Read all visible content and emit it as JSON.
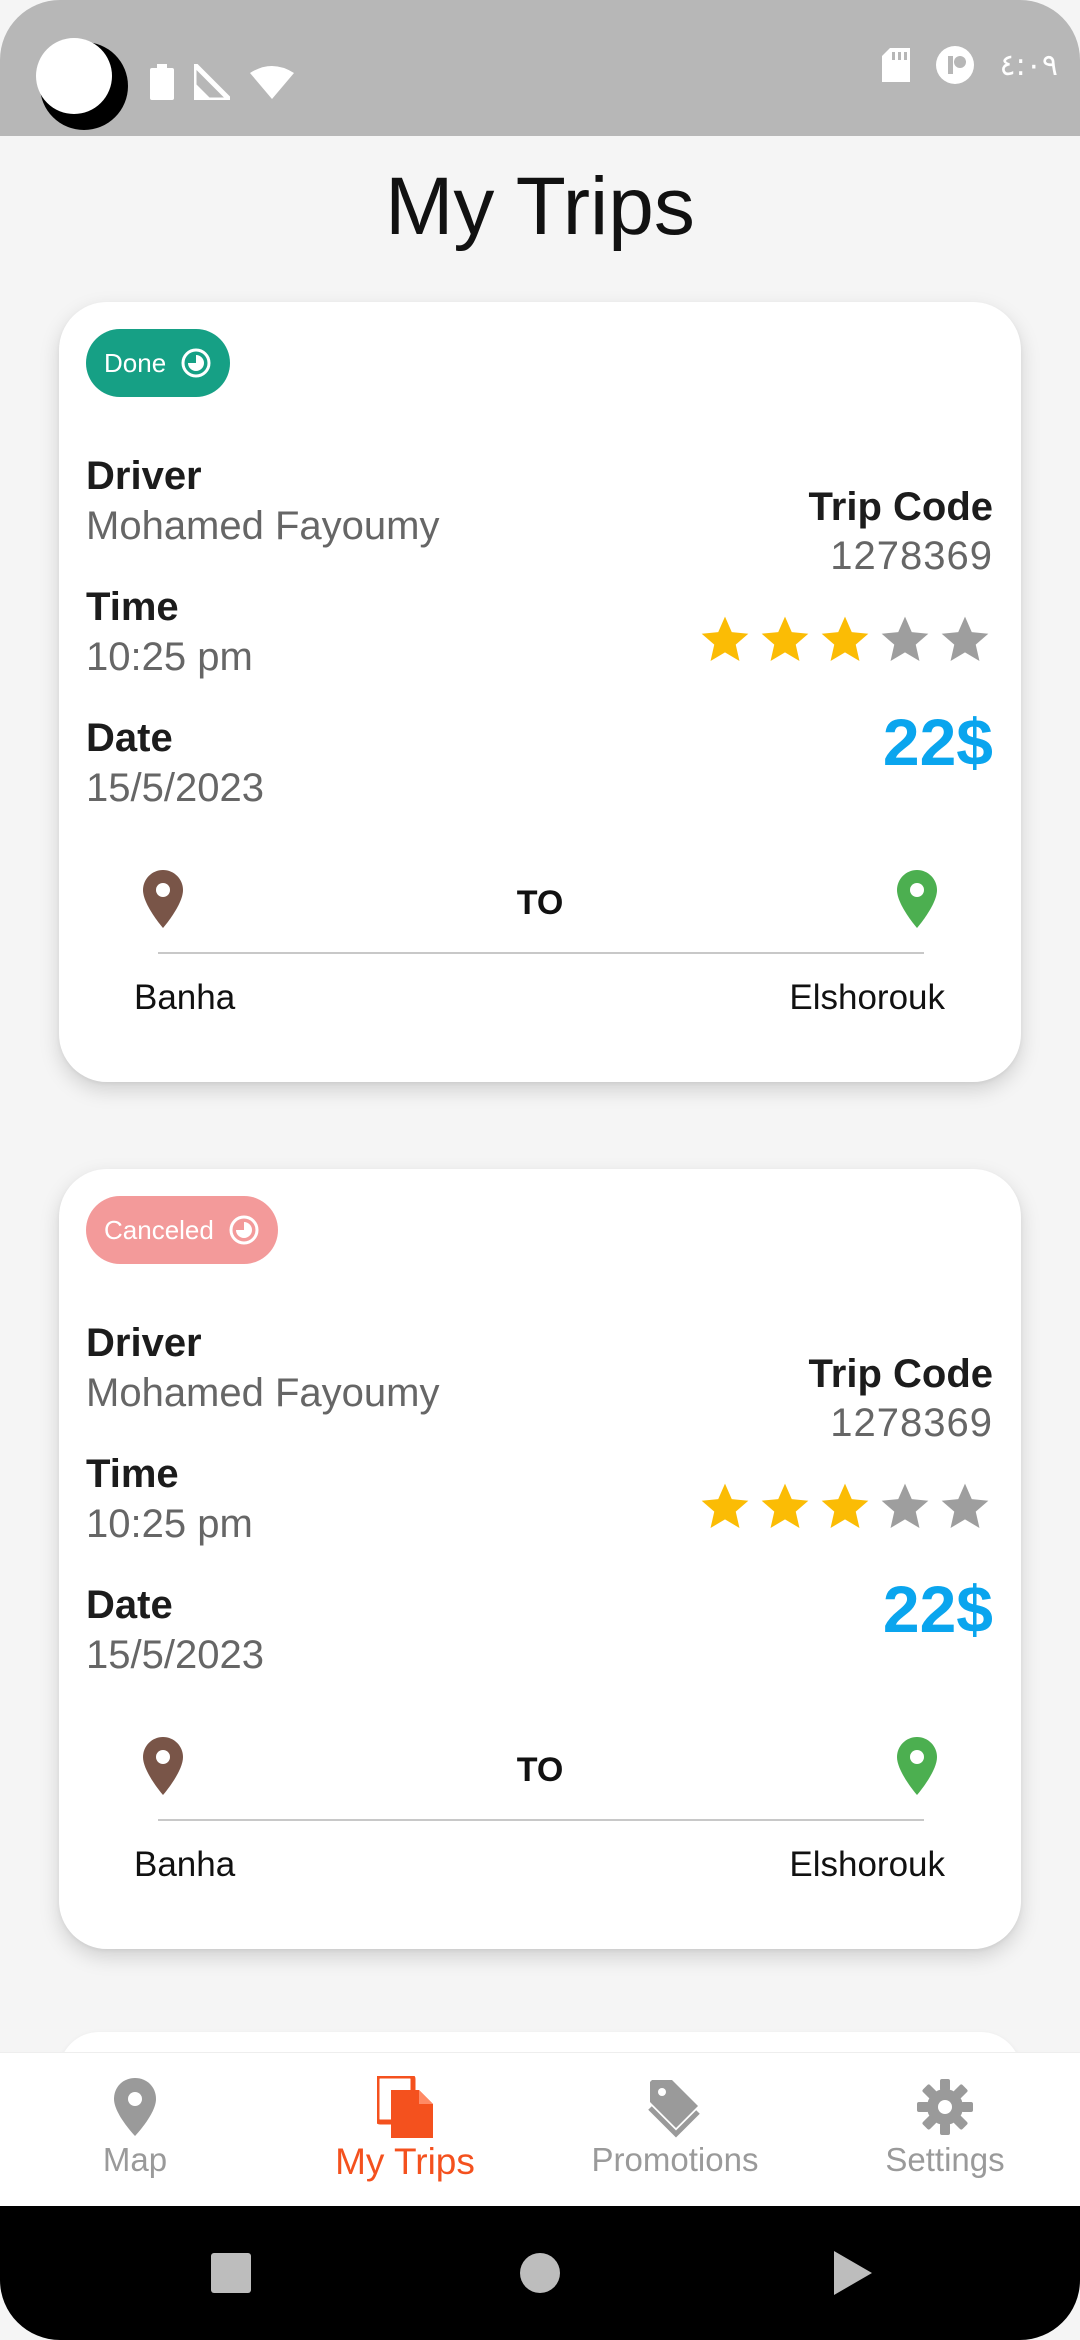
{
  "status_bar": {
    "time": "٤:٠٩"
  },
  "page": {
    "title": "My Trips"
  },
  "labels": {
    "driver": "Driver",
    "time": "Time",
    "date": "Date",
    "trip_code": "Trip Code",
    "to": "TO"
  },
  "trips": [
    {
      "status": "Done",
      "status_color": "#16a085",
      "driver": "Mohamed Fayoumy",
      "time": "10:25 pm",
      "date": "15/5/2023",
      "trip_code": "1278369",
      "rating": 3,
      "rating_max": 5,
      "price": "22$",
      "from": "Banha",
      "to": "Elshorouk"
    },
    {
      "status": "Canceled",
      "status_color": "#f39a9a",
      "driver": "Mohamed Fayoumy",
      "time": "10:25 pm",
      "date": "15/5/2023",
      "trip_code": "1278369",
      "rating": 3,
      "rating_max": 5,
      "price": "22$",
      "from": "Banha",
      "to": "Elshorouk"
    }
  ],
  "bottom_nav": {
    "items": [
      {
        "label": "Map",
        "icon": "map-pin-icon",
        "active": false
      },
      {
        "label": "My Trips",
        "icon": "documents-icon",
        "active": true
      },
      {
        "label": "Promotions",
        "icon": "tag-icon",
        "active": false
      },
      {
        "label": "Settings",
        "icon": "gear-icon",
        "active": false
      }
    ]
  },
  "colors": {
    "accent": "#f4511e",
    "price": "#0aa5ee",
    "star_filled": "#fbbc05",
    "star_empty": "#9e9e9e",
    "from_pin": "#795548",
    "to_pin": "#4caf50"
  }
}
